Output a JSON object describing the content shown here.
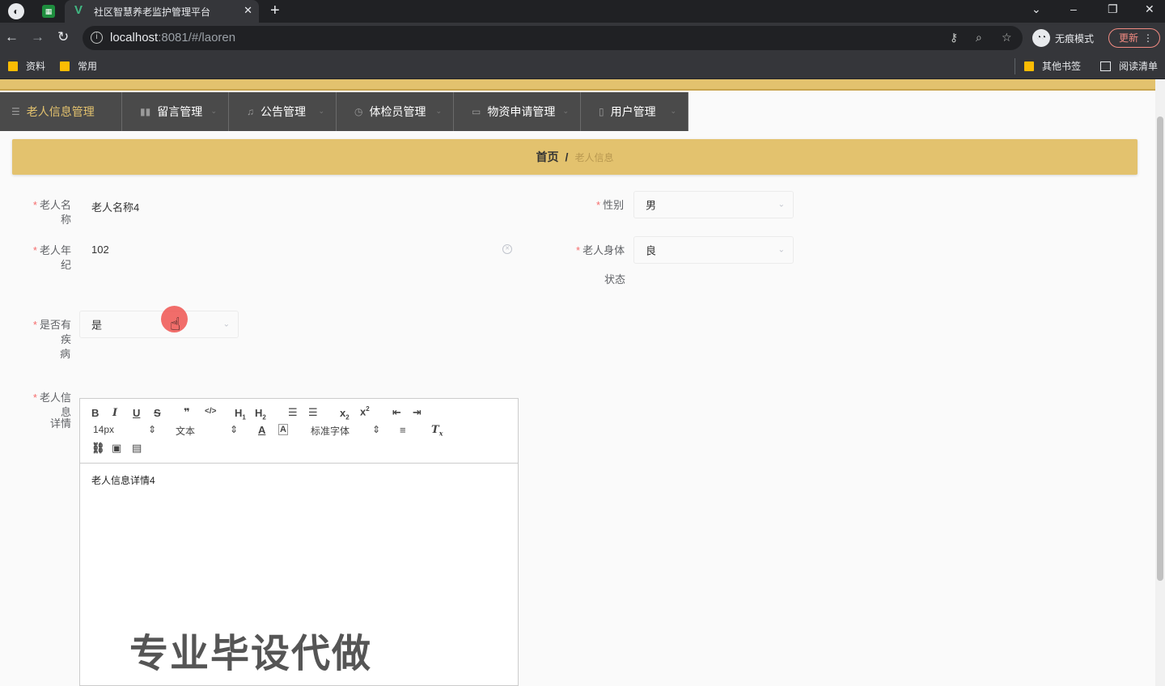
{
  "browser": {
    "tab_title": "社区智慧养老监护管理平台",
    "url_host": "localhost",
    "url_rest": ":8081/#/laoren",
    "incognito_label": "无痕模式",
    "update_label": "更新",
    "bookmarks": [
      "资料",
      "常用"
    ],
    "bookmarks_right": [
      "其他书签",
      "阅读清单"
    ]
  },
  "menu": {
    "items": [
      {
        "label": "老人信息管理",
        "icon": "menu-icon"
      },
      {
        "label": "留言管理",
        "icon": "chart-icon"
      },
      {
        "label": "公告管理",
        "icon": "bell-icon"
      },
      {
        "label": "体检员管理",
        "icon": "clock-icon"
      },
      {
        "label": "物资申请管理",
        "icon": "message-icon"
      },
      {
        "label": "用户管理",
        "icon": "phone-icon"
      }
    ]
  },
  "breadcrumb": {
    "home": "首页",
    "separator": "/",
    "current": "老人信息"
  },
  "form": {
    "required_mark": "*",
    "name_label": "老人名称",
    "name_value": "老人名称4",
    "gender_label": "性别",
    "gender_value": "男",
    "age_label": "老人年纪",
    "age_value": "102",
    "health_label_1": "老人身体",
    "health_label_2": "状态",
    "health_value": "良",
    "disease_label_1": "是否有疾",
    "disease_label_2": "病",
    "disease_value": "是",
    "detail_label_1": "老人信息",
    "detail_label_2": "详情"
  },
  "editor": {
    "font_size": "14px",
    "text_style": "文本",
    "font_family": "标准字体",
    "content": "老人信息详情4"
  },
  "watermark": "专业毕设代做",
  "colors": {
    "accent": "#e3c26e",
    "menu_bg": "#4a4a4a",
    "required": "#f56c6c"
  }
}
